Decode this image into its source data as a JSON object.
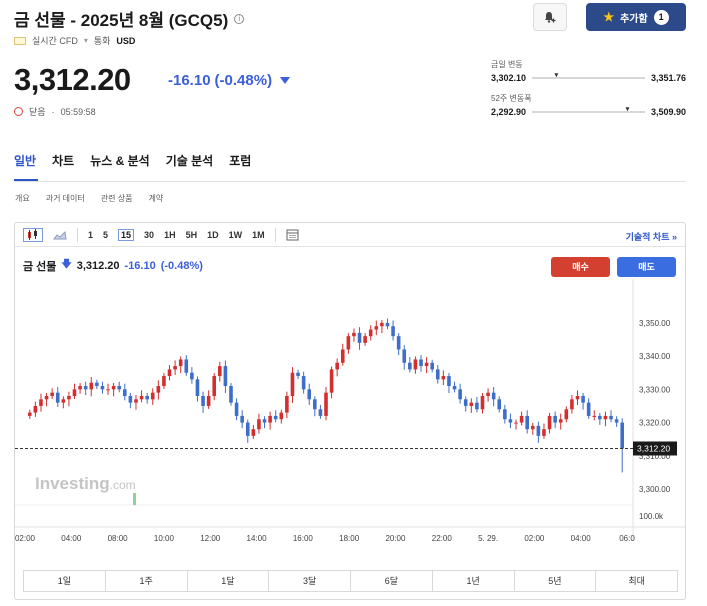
{
  "header": {
    "title": "금 선물 - 2025년 8월 (GCQ5)",
    "info_symbol": "i",
    "realtime": "실시간 CFD",
    "currency_label": "통화",
    "currency": "USD",
    "add_label": "추가함",
    "add_count": "1"
  },
  "quote": {
    "price": "3,312.20",
    "change": "-16.10",
    "change_pct": "(-0.48%)",
    "status": "닫음",
    "time": "05:59:58"
  },
  "ranges": {
    "day_label": "금일 변동",
    "day_low": "3,302.10",
    "day_high": "3,351.76",
    "week52_label": "52주 변동폭",
    "week52_low": "2,292.90",
    "week52_high": "3,509.90"
  },
  "tabs": [
    "일반",
    "차트",
    "뉴스 & 분석",
    "기술 분석",
    "포럼"
  ],
  "subtabs": [
    "개요",
    "과거 데이터",
    "관련 상품",
    "계약"
  ],
  "toolbar": {
    "intervals": [
      "1",
      "5",
      "15",
      "30",
      "1H",
      "5H",
      "1D",
      "1W",
      "1M"
    ],
    "selected_interval": "15",
    "tech_chart": "기술적 차트 »"
  },
  "legend": {
    "name": "금 선물",
    "price": "3,312.20",
    "change": "-16.10",
    "change_pct": "(-0.48%)"
  },
  "buttons": {
    "buy": "매수",
    "sell": "매도"
  },
  "watermark": {
    "main": "Investing",
    "suffix": ".com"
  },
  "periods": [
    "1일",
    "1주",
    "1달",
    "3달",
    "6달",
    "1년",
    "5년",
    "최대"
  ],
  "colors": {
    "up": "#d32f2f",
    "down": "#3e6ec9",
    "accent": "#2c55c9",
    "buy": "#d4402f",
    "sell": "#3a6de0"
  },
  "chart_data": {
    "type": "candlestick",
    "y_ticks": [
      "3,350.00",
      "3,340.00",
      "3,330.00",
      "3,320.00",
      "3,310.00",
      "3,300.00"
    ],
    "y_tick_values": [
      3350,
      3340,
      3330,
      3320,
      3310,
      3300
    ],
    "ylim": [
      3297,
      3362
    ],
    "x_ticks": [
      "02:00",
      "04:00",
      "08:00",
      "10:00",
      "12:00",
      "14:00",
      "16:00",
      "18:00",
      "20:00",
      "22:00",
      "5. 29.",
      "02:00",
      "04:00",
      "06:0"
    ],
    "current_price_label": "3,312.20",
    "current_price": 3312.2,
    "volume_tick": "100.0k",
    "closes": [
      3323,
      3325,
      3327,
      3328,
      3329,
      3326,
      3327,
      3328,
      3330,
      3331,
      3330,
      3332,
      3331,
      3330,
      3330,
      3331,
      3330,
      3328,
      3326,
      3327,
      3328,
      3327,
      3329,
      3331,
      3334,
      3336,
      3337,
      3339,
      3335,
      3333,
      3328,
      3325,
      3328,
      3334,
      3337,
      3331,
      3326,
      3322,
      3320,
      3316,
      3318,
      3321,
      3320,
      3322,
      3321,
      3323,
      3328,
      3335,
      3334,
      3330,
      3327,
      3324,
      3322,
      3329,
      3336,
      3338,
      3342,
      3346,
      3347,
      3344,
      3346,
      3348,
      3349,
      3350,
      3349,
      3346,
      3342,
      3338,
      3336,
      3339,
      3337,
      3338,
      3336,
      3333,
      3334,
      3331,
      3330,
      3327,
      3325,
      3326,
      3324,
      3328,
      3329,
      3327,
      3324,
      3321,
      3320,
      3320,
      3322,
      3318,
      3319,
      3316,
      3318,
      3322,
      3320,
      3321,
      3324,
      3327,
      3328,
      3326,
      3322,
      3322,
      3321,
      3322,
      3321,
      3320,
      3312.2
    ]
  }
}
